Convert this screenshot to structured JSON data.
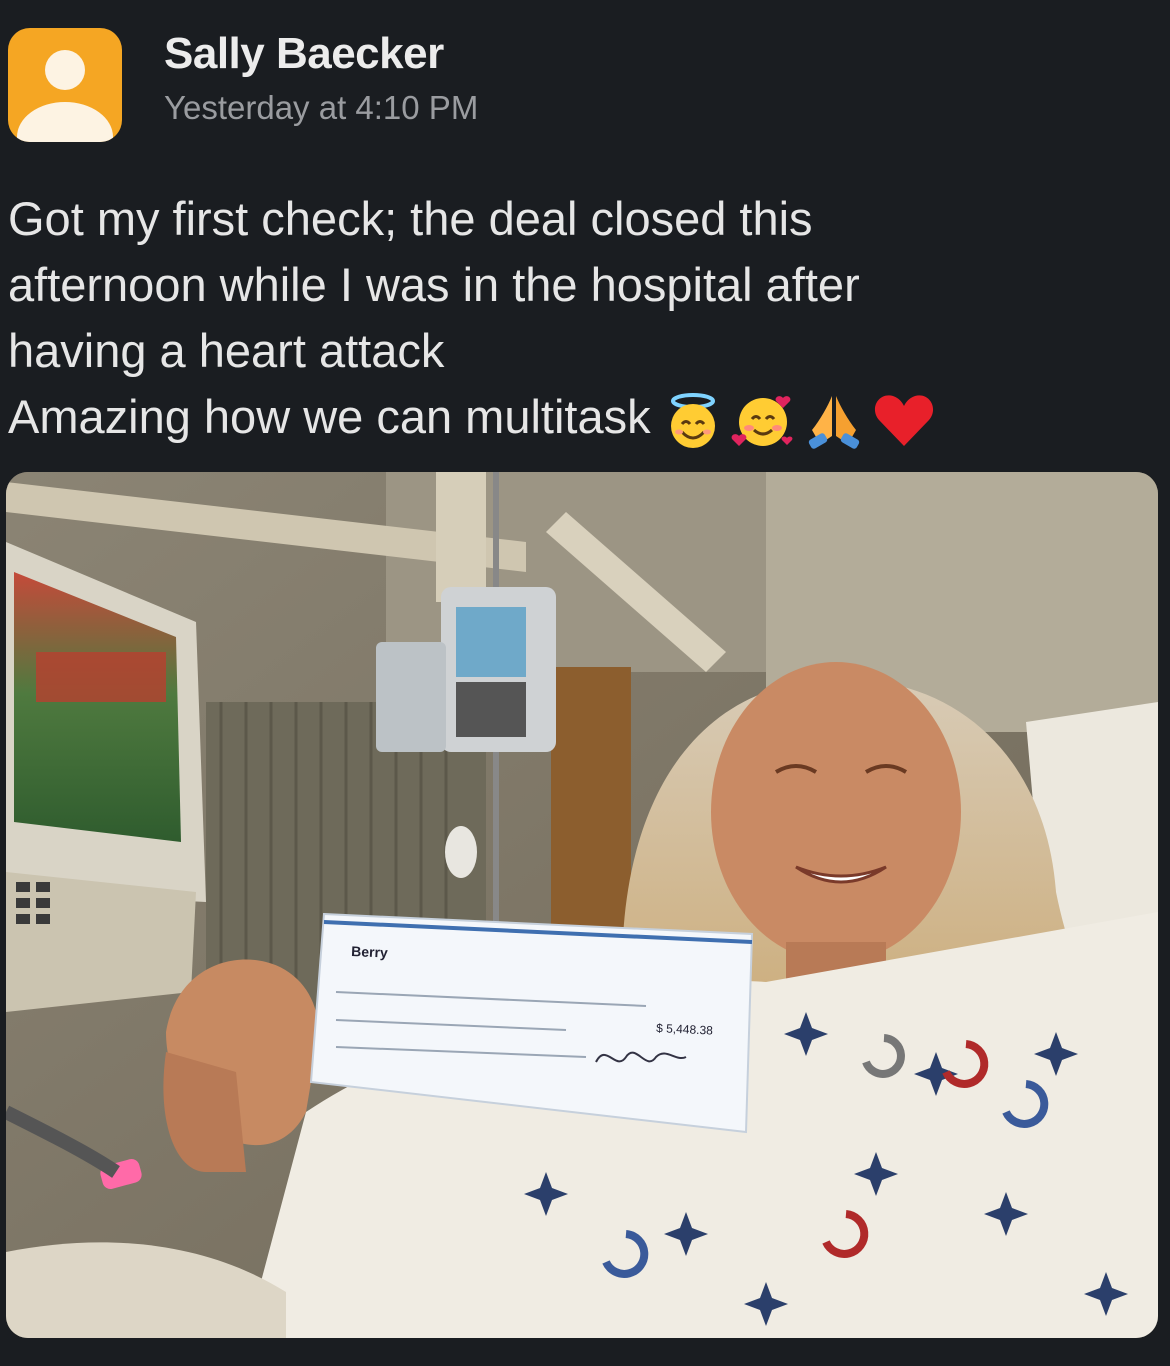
{
  "post": {
    "author": "Sally Baecker",
    "timestamp": "Yesterday at 4:10 PM",
    "avatar_icon": "user-avatar-icon",
    "avatar_color": "#f5a623",
    "message_lines": [
      "Got my first check; the deal closed this",
      "afternoon while I was in the hospital after",
      "having a heart attack",
      "Amazing how we can multitask"
    ],
    "emojis": [
      "smiling-face-with-halo-icon",
      "smiling-face-with-hearts-icon",
      "folded-hands-icon",
      "red-heart-icon"
    ]
  },
  "attachment": {
    "type": "photo",
    "check_text": {
      "payer": "Berry",
      "amount": "$ 5,448.38"
    }
  }
}
